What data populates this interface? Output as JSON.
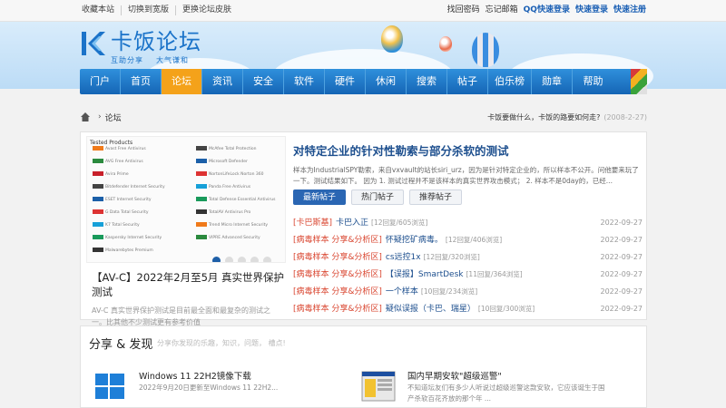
{
  "topbar": {
    "left": [
      "收藏本站",
      "切换到宽版",
      "更换论坛皮肤"
    ],
    "right": [
      {
        "label": "找回密码",
        "bold": false
      },
      {
        "label": "忘记邮箱",
        "bold": false
      },
      {
        "label": "QQ快速登录",
        "bold": true
      },
      {
        "label": "快速登录",
        "bold": true
      },
      {
        "label": "快速注册",
        "bold": true
      }
    ]
  },
  "logo": {
    "name": "卡饭论坛",
    "slogan_left": "互助分享",
    "slogan_right": "大气谦和"
  },
  "nav": {
    "items": [
      "门户",
      "首页",
      "论坛",
      "资讯",
      "安全",
      "软件",
      "硬件",
      "休闲",
      "搜索",
      "帖子",
      "伯乐榜",
      "勋章",
      "帮助"
    ],
    "active_index": 2
  },
  "breadcrumb": {
    "current": "论坛",
    "news_text": "卡饭要做什么，卡饭的路要如何走?",
    "news_date": "(2008-2-27)"
  },
  "slider": {
    "image_heading": "Tested Products",
    "products_left": [
      "Avast Free Antivirus",
      "AVG Free Antivirus",
      "Avira Prime",
      "Bitdefender Internet Security",
      "ESET Internet Security",
      "G Data Total Security",
      "K7 Total Security",
      "Kaspersky Internet Security",
      "Malwarebytes Premium"
    ],
    "products_right": [
      "McAfee Total Protection",
      "Microsoft Defender",
      "NortonLifeLock Norton 360",
      "Panda Free Antivirus",
      "Total Defense Essential Antivirus",
      "TotalAV Antivirus Pro",
      "Trend Micro Internet Security",
      "VIPRE Advanced Security",
      ""
    ],
    "slide_count": 5,
    "active_slide": 0,
    "title": "【AV-C】2022年2月至5月 真实世界保护测试",
    "description": "AV-C 真实世界保护测试是目前最全面和最复杂的测试之一。比其他不少测试更有参考价值"
  },
  "feature": {
    "title": "对特定企业的针对性勒索与部分杀软的测试",
    "description": "样本为IndustrialSPY勒索，来自vxvault的站长siri_urz，因为是针对特定企业的，所以样本不公开。问他要来玩了一下。测试结果如下。 因为 1. 测试过程并不是该样本的真实世界攻击模式； 2. 样本不是0day的，已经..."
  },
  "tabs": [
    {
      "label": "最新帖子",
      "active": true
    },
    {
      "label": "热门帖子",
      "active": false
    },
    {
      "label": "推荐帖子",
      "active": false
    }
  ],
  "posts": [
    {
      "category": "[卡巴斯基]",
      "title": "卡巴入正",
      "meta": "[12回复/605浏览]",
      "date": "2022-09-27"
    },
    {
      "category": "[病毒样本 分享&分析区]",
      "title": "怀疑挖矿病毒。",
      "meta": "[12回复/406浏览]",
      "date": "2022-09-27"
    },
    {
      "category": "[病毒样本 分享&分析区]",
      "title": "cs远控1x",
      "meta": "[12回复/320浏览]",
      "date": "2022-09-27"
    },
    {
      "category": "[病毒样本 分享&分析区]",
      "title": "【误报】SmartDesk",
      "meta": "[11回复/364浏览]",
      "date": "2022-09-27"
    },
    {
      "category": "[病毒样本 分享&分析区]",
      "title": "一个样本",
      "meta": "[10回复/234浏览]",
      "date": "2022-09-27"
    },
    {
      "category": "[病毒样本 分享&分析区]",
      "title": "疑似误报（卡巴、瑞星）",
      "meta": "[10回复/300浏览]",
      "date": "2022-09-27"
    }
  ],
  "share": {
    "heading": "分享 & 发现",
    "subtitle": "分享你发现的乐趣，知识，问题，     槽点!",
    "cards": [
      {
        "title": "Windows 11 22H2镜像下载",
        "desc": "2022年9月20日更新至Windows 11 22H2...",
        "icon": "windows-logo"
      },
      {
        "title": "国内早期安软\"超级巡警\"",
        "desc": "不知道坛友们有多少人听说过超级巡警这款安软，它应该诞生于国产杀软百花齐放的那个年 ...",
        "icon": "software-screenshot"
      }
    ]
  },
  "colors": {
    "nav": "#1b73c9",
    "nav_active": "#f4a21a",
    "link": "#1d4f8e",
    "category": "#d9452f"
  }
}
